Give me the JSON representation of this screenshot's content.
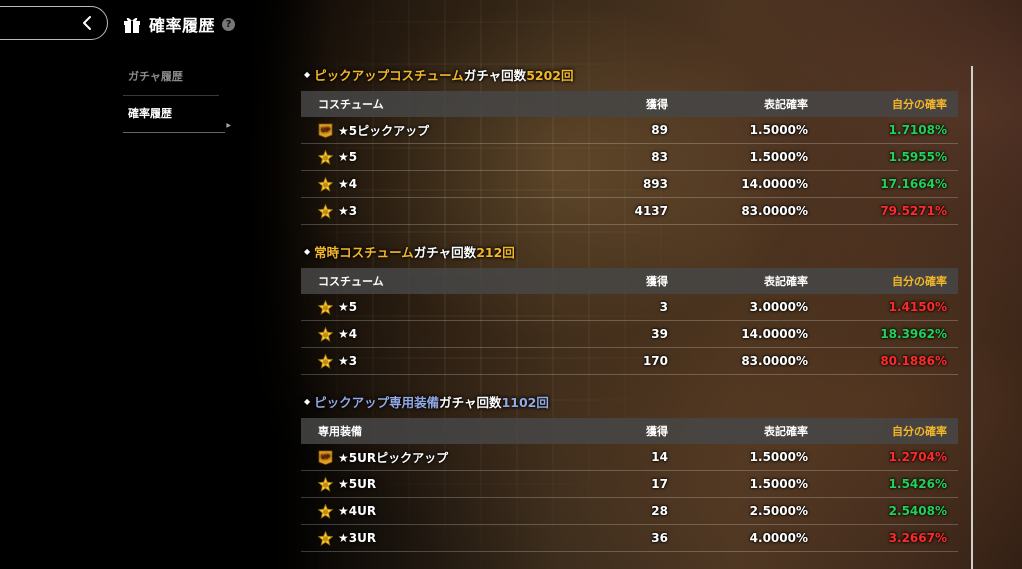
{
  "header": {
    "title": "確率履歴",
    "help_label": "?"
  },
  "sidebar": {
    "items": [
      {
        "label": "ガチャ履歴"
      },
      {
        "label": "確率履歴"
      }
    ]
  },
  "sections": [
    {
      "title_part1": "ピックアップコスチューム",
      "title_part2": "ガチャ回数",
      "title_count": "5202回",
      "columns": [
        "コスチューム",
        "獲得",
        "表記確率",
        "自分の確率"
      ],
      "rows": [
        {
          "icon": "up-badge-icon",
          "name": "★5ピックアップ",
          "count": "89",
          "rate": "1.5000%",
          "mine": "1.7108%",
          "mine_color": "green"
        },
        {
          "icon": "star-badge-icon",
          "name": "★5",
          "count": "83",
          "rate": "1.5000%",
          "mine": "1.5955%",
          "mine_color": "green"
        },
        {
          "icon": "star-badge-icon",
          "name": "★4",
          "count": "893",
          "rate": "14.0000%",
          "mine": "17.1664%",
          "mine_color": "green"
        },
        {
          "icon": "star-badge-icon",
          "name": "★3",
          "count": "4137",
          "rate": "83.0000%",
          "mine": "79.5271%",
          "mine_color": "red"
        }
      ]
    },
    {
      "title_part1": "常時コスチューム",
      "title_part2": "ガチャ回数",
      "title_count": "212回",
      "columns": [
        "コスチューム",
        "獲得",
        "表記確率",
        "自分の確率"
      ],
      "rows": [
        {
          "icon": "star-badge-icon",
          "name": "★5",
          "count": "3",
          "rate": "3.0000%",
          "mine": "1.4150%",
          "mine_color": "red"
        },
        {
          "icon": "star-badge-icon",
          "name": "★4",
          "count": "39",
          "rate": "14.0000%",
          "mine": "18.3962%",
          "mine_color": "green"
        },
        {
          "icon": "star-badge-icon",
          "name": "★3",
          "count": "170",
          "rate": "83.0000%",
          "mine": "80.1886%",
          "mine_color": "red"
        }
      ]
    },
    {
      "title_part1": "ピックアップ専用装備",
      "title_part2": "ガチャ回数",
      "title_count": "1102回",
      "columns": [
        "専用装備",
        "獲得",
        "表記確率",
        "自分の確率"
      ],
      "rows": [
        {
          "icon": "up-badge-icon",
          "name": "★5URピックアップ",
          "count": "14",
          "rate": "1.5000%",
          "mine": "1.2704%",
          "mine_color": "red"
        },
        {
          "icon": "star-badge-icon",
          "name": "★5UR",
          "count": "17",
          "rate": "1.5000%",
          "mine": "1.5426%",
          "mine_color": "green"
        },
        {
          "icon": "star-badge-icon",
          "name": "★4UR",
          "count": "28",
          "rate": "2.5000%",
          "mine": "2.5408%",
          "mine_color": "green"
        },
        {
          "icon": "star-badge-icon",
          "name": "★3UR",
          "count": "36",
          "rate": "4.0000%",
          "mine": "3.2667%",
          "mine_color": "red"
        }
      ]
    }
  ],
  "colors": {
    "accent_gold": "#f3b72a",
    "equip_blue": "#93a9e3",
    "green": "#22d15a",
    "red": "#ff2a2a"
  }
}
